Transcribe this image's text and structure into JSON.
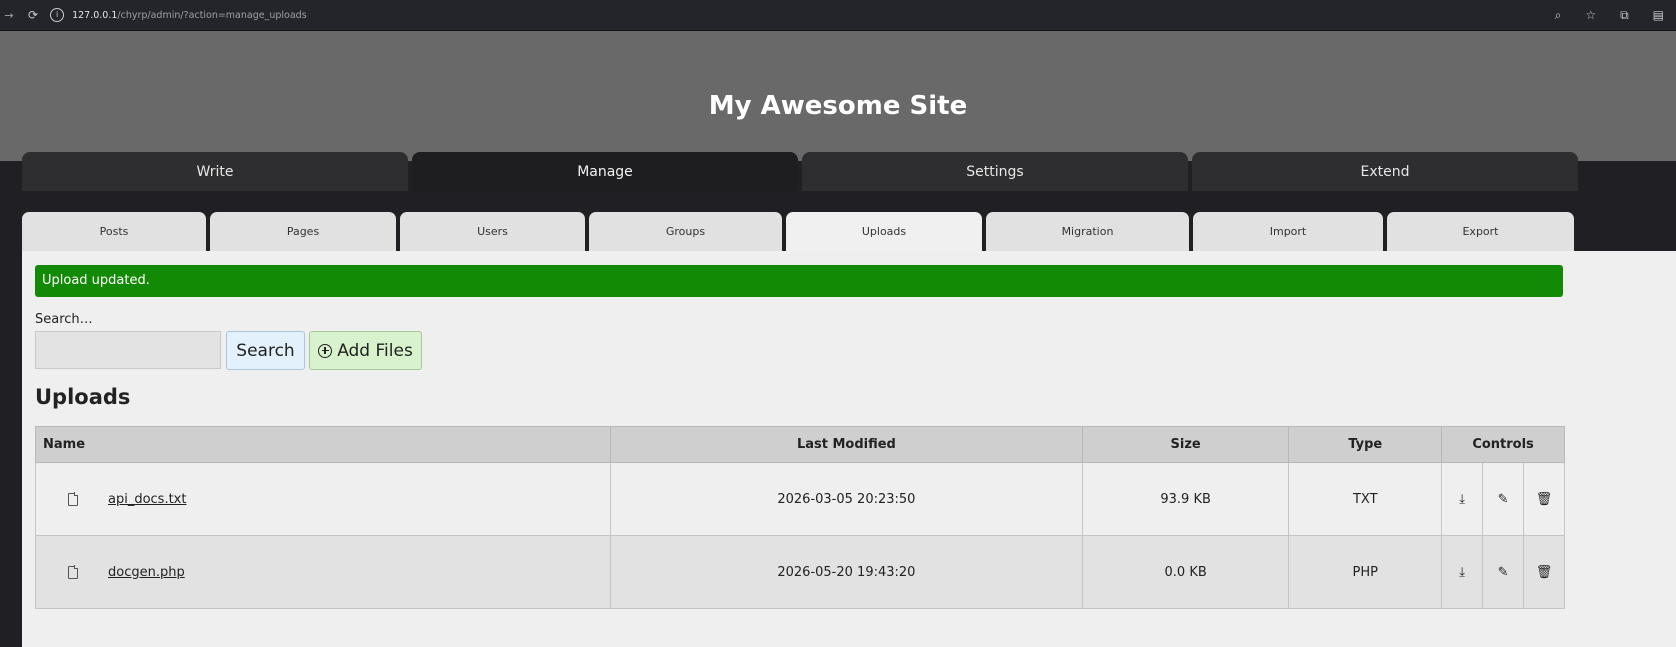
{
  "browser": {
    "url_host": "127.0.0.1",
    "url_path": "/chyrp/admin/?action=manage_uploads"
  },
  "site": {
    "title": "My Awesome Site"
  },
  "main_nav": [
    {
      "label": "Write"
    },
    {
      "label": "Manage",
      "active": true
    },
    {
      "label": "Settings"
    },
    {
      "label": "Extend"
    }
  ],
  "sub_nav": [
    {
      "label": "Posts"
    },
    {
      "label": "Pages"
    },
    {
      "label": "Users"
    },
    {
      "label": "Groups"
    },
    {
      "label": "Uploads",
      "active": true
    },
    {
      "label": "Migration"
    },
    {
      "label": "Import"
    },
    {
      "label": "Export"
    }
  ],
  "flash": {
    "message": "Upload updated.",
    "color": "#138a05"
  },
  "search": {
    "label": "Search…",
    "value": "",
    "button": "Search"
  },
  "add_files": {
    "label": "Add Files"
  },
  "uploads": {
    "title": "Uploads",
    "columns": [
      "Name",
      "Last Modified",
      "Size",
      "Type",
      "Controls"
    ],
    "rows": [
      {
        "name": "api_docs.txt",
        "modified": "2026-03-05 20:23:50",
        "size": "93.9 KB",
        "type": "TXT"
      },
      {
        "name": "docgen.php",
        "modified": "2026-05-20 19:43:20",
        "size": "0.0 KB",
        "type": "PHP"
      }
    ]
  }
}
